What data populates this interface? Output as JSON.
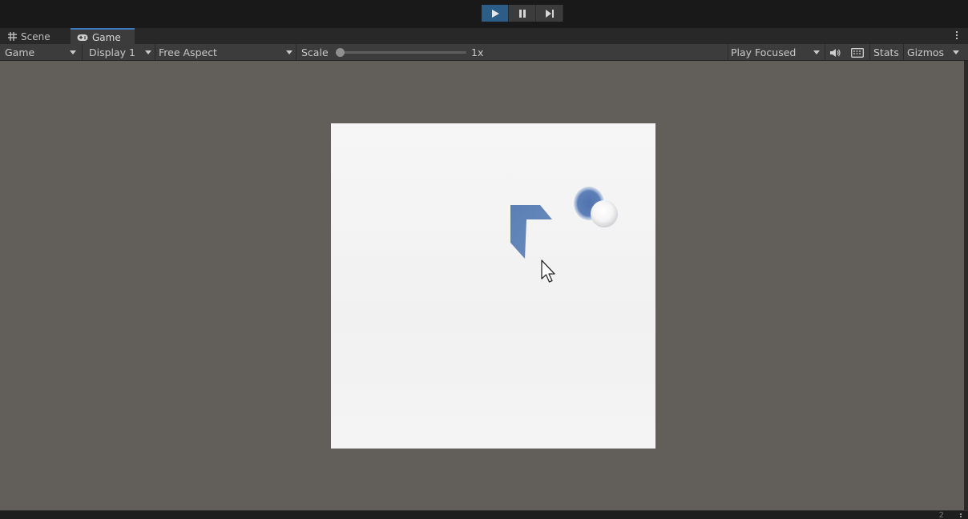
{
  "play_controls": {
    "play": "play-icon",
    "pause": "pause-icon",
    "step": "step-icon",
    "play_active_color": "#2c5d87"
  },
  "tabs": {
    "scene": "Scene",
    "game": "Game"
  },
  "toolbar": {
    "view_mode": "Game",
    "display": "Display 1",
    "aspect": "Free Aspect",
    "scale_label": "Scale",
    "scale_value": "1x",
    "scale_fraction": 0.0,
    "play_mode": "Play Focused",
    "stats": "Stats",
    "gizmos": "Gizmos"
  },
  "game_scene": {
    "background": "#f4f4f4",
    "object_color": "#5b7eb4",
    "objects": [
      "chevron-shape",
      "sphere"
    ]
  },
  "status": {
    "hint": "2"
  }
}
